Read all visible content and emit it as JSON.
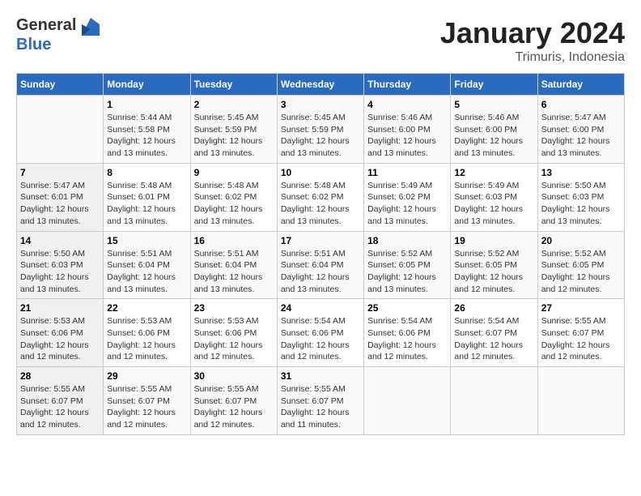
{
  "header": {
    "logo_general": "General",
    "logo_blue": "Blue",
    "month": "January 2024",
    "location": "Trimuris, Indonesia"
  },
  "days_of_week": [
    "Sunday",
    "Monday",
    "Tuesday",
    "Wednesday",
    "Thursday",
    "Friday",
    "Saturday"
  ],
  "weeks": [
    [
      {
        "day": "",
        "sunrise": "",
        "sunset": "",
        "daylight": ""
      },
      {
        "day": "1",
        "sunrise": "5:44 AM",
        "sunset": "5:58 PM",
        "daylight": "12 hours and 13 minutes."
      },
      {
        "day": "2",
        "sunrise": "5:45 AM",
        "sunset": "5:59 PM",
        "daylight": "12 hours and 13 minutes."
      },
      {
        "day": "3",
        "sunrise": "5:45 AM",
        "sunset": "5:59 PM",
        "daylight": "12 hours and 13 minutes."
      },
      {
        "day": "4",
        "sunrise": "5:46 AM",
        "sunset": "6:00 PM",
        "daylight": "12 hours and 13 minutes."
      },
      {
        "day": "5",
        "sunrise": "5:46 AM",
        "sunset": "6:00 PM",
        "daylight": "12 hours and 13 minutes."
      },
      {
        "day": "6",
        "sunrise": "5:47 AM",
        "sunset": "6:00 PM",
        "daylight": "12 hours and 13 minutes."
      }
    ],
    [
      {
        "day": "7",
        "sunrise": "5:47 AM",
        "sunset": "6:01 PM",
        "daylight": "12 hours and 13 minutes."
      },
      {
        "day": "8",
        "sunrise": "5:48 AM",
        "sunset": "6:01 PM",
        "daylight": "12 hours and 13 minutes."
      },
      {
        "day": "9",
        "sunrise": "5:48 AM",
        "sunset": "6:02 PM",
        "daylight": "12 hours and 13 minutes."
      },
      {
        "day": "10",
        "sunrise": "5:48 AM",
        "sunset": "6:02 PM",
        "daylight": "12 hours and 13 minutes."
      },
      {
        "day": "11",
        "sunrise": "5:49 AM",
        "sunset": "6:02 PM",
        "daylight": "12 hours and 13 minutes."
      },
      {
        "day": "12",
        "sunrise": "5:49 AM",
        "sunset": "6:03 PM",
        "daylight": "12 hours and 13 minutes."
      },
      {
        "day": "13",
        "sunrise": "5:50 AM",
        "sunset": "6:03 PM",
        "daylight": "12 hours and 13 minutes."
      }
    ],
    [
      {
        "day": "14",
        "sunrise": "5:50 AM",
        "sunset": "6:03 PM",
        "daylight": "12 hours and 13 minutes."
      },
      {
        "day": "15",
        "sunrise": "5:51 AM",
        "sunset": "6:04 PM",
        "daylight": "12 hours and 13 minutes."
      },
      {
        "day": "16",
        "sunrise": "5:51 AM",
        "sunset": "6:04 PM",
        "daylight": "12 hours and 13 minutes."
      },
      {
        "day": "17",
        "sunrise": "5:51 AM",
        "sunset": "6:04 PM",
        "daylight": "12 hours and 13 minutes."
      },
      {
        "day": "18",
        "sunrise": "5:52 AM",
        "sunset": "6:05 PM",
        "daylight": "12 hours and 13 minutes."
      },
      {
        "day": "19",
        "sunrise": "5:52 AM",
        "sunset": "6:05 PM",
        "daylight": "12 hours and 12 minutes."
      },
      {
        "day": "20",
        "sunrise": "5:52 AM",
        "sunset": "6:05 PM",
        "daylight": "12 hours and 12 minutes."
      }
    ],
    [
      {
        "day": "21",
        "sunrise": "5:53 AM",
        "sunset": "6:06 PM",
        "daylight": "12 hours and 12 minutes."
      },
      {
        "day": "22",
        "sunrise": "5:53 AM",
        "sunset": "6:06 PM",
        "daylight": "12 hours and 12 minutes."
      },
      {
        "day": "23",
        "sunrise": "5:53 AM",
        "sunset": "6:06 PM",
        "daylight": "12 hours and 12 minutes."
      },
      {
        "day": "24",
        "sunrise": "5:54 AM",
        "sunset": "6:06 PM",
        "daylight": "12 hours and 12 minutes."
      },
      {
        "day": "25",
        "sunrise": "5:54 AM",
        "sunset": "6:06 PM",
        "daylight": "12 hours and 12 minutes."
      },
      {
        "day": "26",
        "sunrise": "5:54 AM",
        "sunset": "6:07 PM",
        "daylight": "12 hours and 12 minutes."
      },
      {
        "day": "27",
        "sunrise": "5:55 AM",
        "sunset": "6:07 PM",
        "daylight": "12 hours and 12 minutes."
      }
    ],
    [
      {
        "day": "28",
        "sunrise": "5:55 AM",
        "sunset": "6:07 PM",
        "daylight": "12 hours and 12 minutes."
      },
      {
        "day": "29",
        "sunrise": "5:55 AM",
        "sunset": "6:07 PM",
        "daylight": "12 hours and 12 minutes."
      },
      {
        "day": "30",
        "sunrise": "5:55 AM",
        "sunset": "6:07 PM",
        "daylight": "12 hours and 12 minutes."
      },
      {
        "day": "31",
        "sunrise": "5:55 AM",
        "sunset": "6:07 PM",
        "daylight": "12 hours and 11 minutes."
      },
      {
        "day": "",
        "sunrise": "",
        "sunset": "",
        "daylight": ""
      },
      {
        "day": "",
        "sunrise": "",
        "sunset": "",
        "daylight": ""
      },
      {
        "day": "",
        "sunrise": "",
        "sunset": "",
        "daylight": ""
      }
    ]
  ]
}
